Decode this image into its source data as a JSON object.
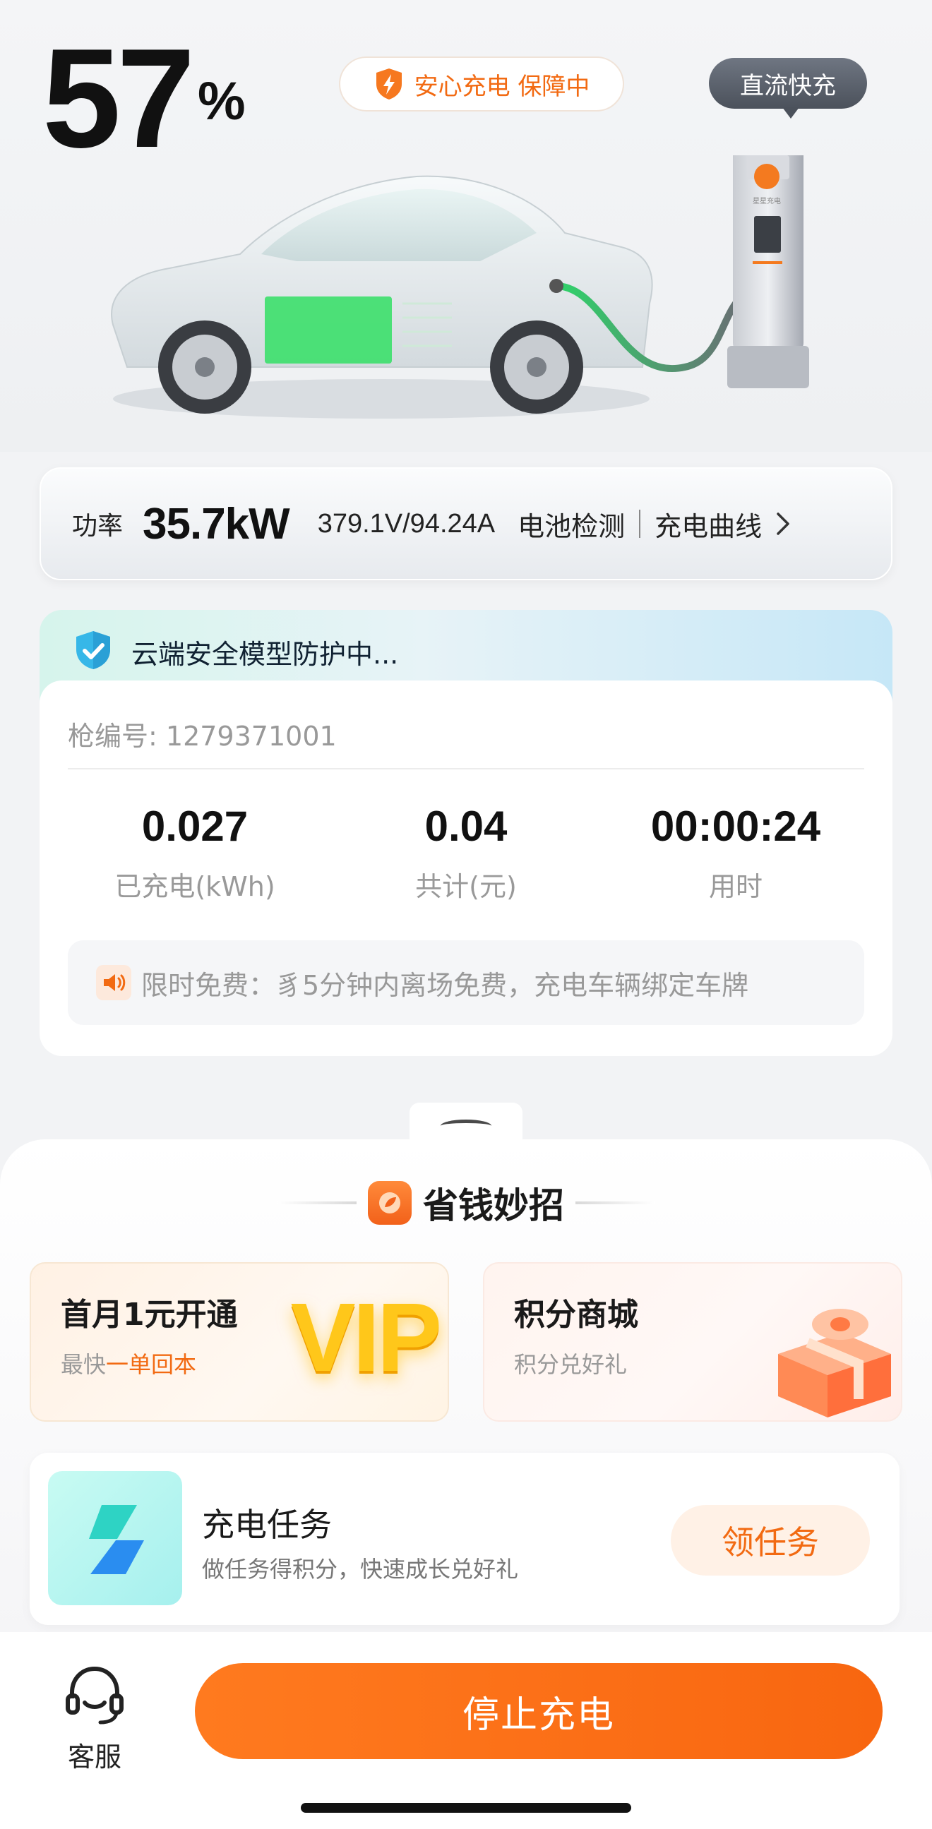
{
  "battery": {
    "percent": "57",
    "unit": "%"
  },
  "safe_charge": {
    "label": "安心充电 保障中"
  },
  "charger_type": {
    "label": "直流快充"
  },
  "scene": {
    "station_brand": "星星充电"
  },
  "power": {
    "label": "功率",
    "value": "35.7kW",
    "voltage_current": "379.1V/94.24A",
    "battery_check": "电池检测",
    "curve": "充电曲线"
  },
  "security": {
    "text": "云端安全模型防护中..."
  },
  "gun": {
    "label": "枪编号:",
    "number": "1279371001"
  },
  "stats": [
    {
      "value": "0.027",
      "label": "已充电(kWh)"
    },
    {
      "value": "0.04",
      "label": "共计(元)"
    },
    {
      "value": "00:00:24",
      "label": "用时"
    }
  ],
  "promo": {
    "text": "限时免费：豸5分钟内离场免费，充电车辆绑定车牌"
  },
  "tips": {
    "title": "省钱妙招",
    "vip": {
      "title": "首月1元开通",
      "subtitle_prefix": "最快",
      "subtitle_highlight": "一单回本",
      "badge": "VIP"
    },
    "mall": {
      "title": "积分商城",
      "subtitle": "积分兑好礼"
    },
    "task": {
      "title": "充电任务",
      "subtitle": "做任务得积分，快速成长兑好礼",
      "button": "领任务"
    }
  },
  "bottom": {
    "service": "客服",
    "stop": "停止充电"
  },
  "colors": {
    "accent": "#F86610",
    "battery_green": "#3FE06E",
    "text_dark": "#111111"
  },
  "icons": [
    "shield-bolt-icon",
    "shield-check-icon",
    "chevron-right-icon",
    "speaker-icon",
    "coin-leaf-icon",
    "gift-box-icon",
    "task-bolt-icon",
    "headset-icon"
  ]
}
